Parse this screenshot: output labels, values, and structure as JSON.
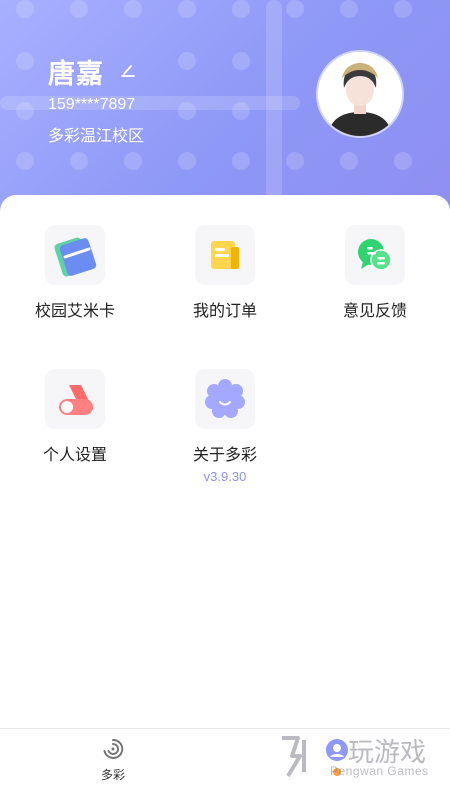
{
  "profile": {
    "name": "唐嘉",
    "phone": "159****7897",
    "campus": "多彩温江校区"
  },
  "menu": [
    {
      "label": "校园艾米卡",
      "icon": "campus-card-icon"
    },
    {
      "label": "我的订单",
      "icon": "orders-icon"
    },
    {
      "label": "意见反馈",
      "icon": "feedback-icon"
    },
    {
      "label": "个人设置",
      "icon": "settings-toggle-icon"
    },
    {
      "label": "关于多彩",
      "icon": "about-flower-icon",
      "sub": "v3.9.30"
    }
  ],
  "tabbar": {
    "home_label": "多彩"
  },
  "watermark": {
    "brand": "玩游戏",
    "sub": "Pengwan Games"
  },
  "colors": {
    "accent": "#8e98f6",
    "version_text": "#8d8ff0"
  }
}
